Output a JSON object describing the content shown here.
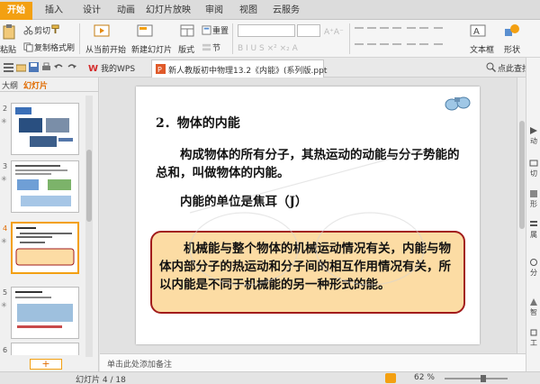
{
  "ribbon": {
    "tabs": [
      {
        "label": "开始",
        "active": true
      },
      {
        "label": "插入"
      },
      {
        "label": "设计"
      },
      {
        "label": "动画"
      },
      {
        "label": "幻灯片放映"
      },
      {
        "label": "审阅"
      },
      {
        "label": "视图"
      },
      {
        "label": "云服务"
      }
    ]
  },
  "toolbar": {
    "paste": "粘贴",
    "cut": "剪切",
    "copy": "复制",
    "format_painter": "格式刷",
    "from_current": "从当前开始",
    "new_slide": "新建幻灯片",
    "layout": "版式",
    "reset": "重置",
    "section": "节",
    "textbox": "文本框",
    "shape": "形状",
    "font_name": "",
    "font_size": ""
  },
  "quickbar": {
    "wps": "我的WPS",
    "doc_title": "新人教版初中物理13.2《内能》(系列版.ppt",
    "search": "点此查找命令"
  },
  "leftpane": {
    "tab_outline": "大纲",
    "tab_slides": "幻灯片",
    "slides": [
      {
        "num": "2",
        "star": "✳"
      },
      {
        "num": "3",
        "star": "✳"
      },
      {
        "num": "4",
        "star": "✳",
        "selected": true
      },
      {
        "num": "5",
        "star": "✳"
      },
      {
        "num": "6",
        "star": ""
      }
    ],
    "add": "+"
  },
  "slide": {
    "title": "2．物体的内能",
    "para1": "构成物体的所有分子，其热运动的动能与分子势能的总和，叫做物体的内能。",
    "para2": "内能的单位是焦耳（J）",
    "callout": "机械能与整个物体的机械运动情况有关，内能与物体内部分子的热运动和分子间的相互作用情况有关，所以内能是不同于机械能的另一种形式的能。"
  },
  "rightbar": {
    "items": [
      "动",
      "切",
      "形",
      "属",
      "分",
      "智",
      "工"
    ]
  },
  "notes": {
    "placeholder": "单击此处添加备注"
  },
  "status": {
    "slide_counter": "幻灯片 4 / 18",
    "zoom": "62 %",
    "zoom_level_percent": 62
  },
  "colors": {
    "accent": "#f3a012",
    "callout_fill": "#fcdca4",
    "callout_border": "#a21c1c"
  }
}
